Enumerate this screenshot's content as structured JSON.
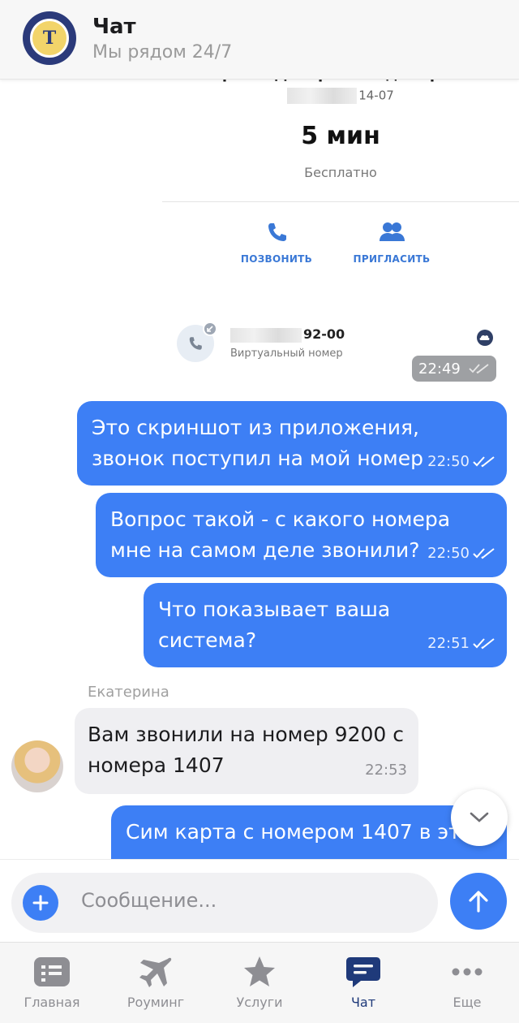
{
  "header": {
    "title": "Чат",
    "subtitle": "Мы рядом 24/7"
  },
  "card": {
    "name": "Сергеев Дмитрий Владимирович",
    "date_suffix": "14-07",
    "duration": "5 мин",
    "price": "Бесплатно",
    "call_button": "ПОЗВОНИТЬ",
    "invite_button": "ПРИГЛАСИТЬ"
  },
  "call_entry": {
    "number_suffix": "92-00",
    "caption": "Виртуальный номер",
    "time": "22:49"
  },
  "messages": [
    {
      "text": "Это скриншот из приложения, звонок поступил на мой номер",
      "time": "22:50"
    },
    {
      "text": "Вопрос такой - с какого номера мне на самом деле звонили?",
      "time": "22:50"
    },
    {
      "text": "Что показывает ваша система?",
      "time": "22:51"
    },
    {
      "sender": "Екатерина",
      "text": "Вам звонили на номер 9200 с номера 1407",
      "time": "22:53"
    },
    {
      "text": "Сим карта с номером 1407 в эт"
    }
  ],
  "composer": {
    "placeholder": "Сообщение..."
  },
  "tabs": [
    {
      "label": "Главная",
      "icon": "home-grid-icon"
    },
    {
      "label": "Роуминг",
      "icon": "plane-icon"
    },
    {
      "label": "Услуги",
      "icon": "star-icon"
    },
    {
      "label": "Чат",
      "icon": "chat-icon",
      "active": true
    },
    {
      "label": "Еще",
      "icon": "more-dots-icon"
    }
  ],
  "colors": {
    "accent": "#3d7ff5",
    "active_tab": "#1f3a7a",
    "incoming_bubble": "#efeff2"
  }
}
